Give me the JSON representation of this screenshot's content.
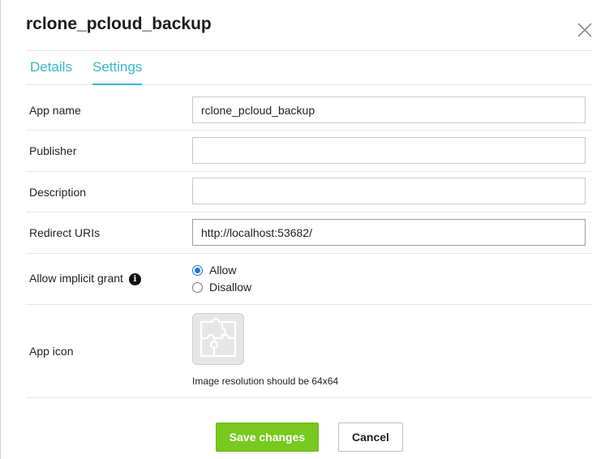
{
  "dialog": {
    "title": "rclone_pcloud_backup",
    "close_icon": "close-icon"
  },
  "tabs": [
    {
      "label": "Details",
      "active": false
    },
    {
      "label": "Settings",
      "active": true
    }
  ],
  "form": {
    "app_name": {
      "label": "App name",
      "value": "rclone_pcloud_backup"
    },
    "publisher": {
      "label": "Publisher",
      "value": ""
    },
    "description": {
      "label": "Description",
      "value": ""
    },
    "redirect_uris": {
      "label": "Redirect URIs",
      "value": "http://localhost:53682/"
    },
    "implicit_grant": {
      "label": "Allow implicit grant",
      "info_icon": "info-icon",
      "options": [
        {
          "label": "Allow",
          "selected": true
        },
        {
          "label": "Disallow",
          "selected": false
        }
      ]
    },
    "app_icon": {
      "label": "App icon",
      "placeholder_icon": "puzzle-icon",
      "hint": "Image resolution should be 64x64"
    }
  },
  "actions": {
    "save_label": "Save changes",
    "cancel_label": "Cancel"
  },
  "colors": {
    "accent": "#35b5d0",
    "save_button": "#77c81f",
    "radio_selected": "#1a73e8"
  }
}
